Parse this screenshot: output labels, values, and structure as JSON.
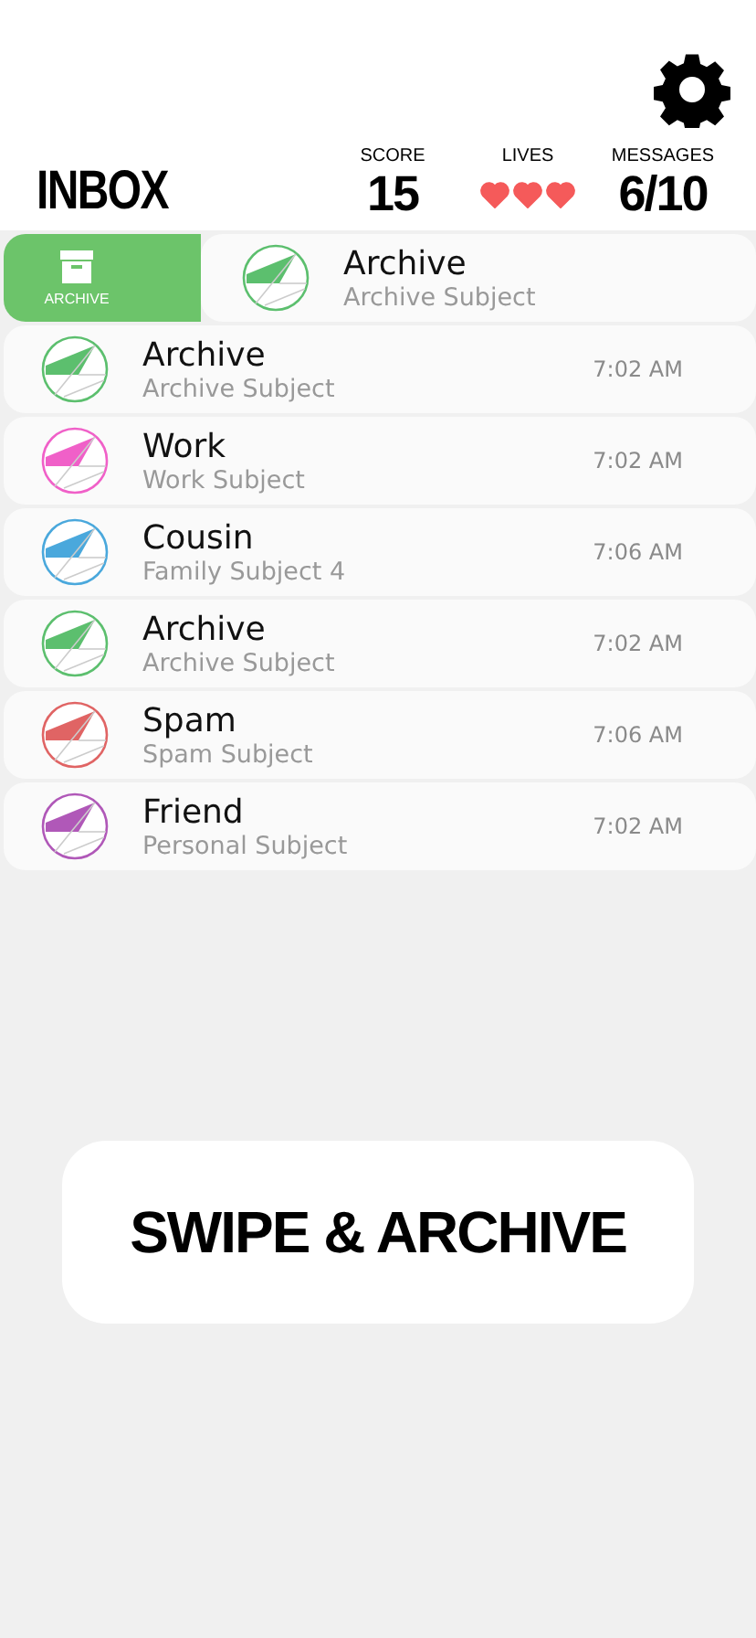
{
  "header": {
    "title": "INBOX",
    "score": {
      "label": "SCORE",
      "value": "15"
    },
    "lives": {
      "label": "LIVES",
      "hearts": [
        {
          "filled": true
        },
        {
          "filled": true
        },
        {
          "filled": true
        }
      ]
    },
    "messages": {
      "label": "MESSAGES",
      "value": "6/10"
    }
  },
  "swipe_action": {
    "label": "ARCHIVE"
  },
  "emails": [
    {
      "sender": "Archive",
      "subject": "Archive Subject",
      "color": "#5cbf6e",
      "swiped": true
    },
    {
      "sender": "Archive",
      "subject": "Archive Subject",
      "time": "7:02 AM",
      "color": "#5cbf6e",
      "swiped": false
    },
    {
      "sender": "Work",
      "subject": "Work Subject",
      "time": "7:02 AM",
      "color": "#f060c8",
      "swiped": false
    },
    {
      "sender": "Cousin",
      "subject": "Family Subject 4",
      "time": "7:06 AM",
      "color": "#4aa8dc",
      "swiped": false
    },
    {
      "sender": "Archive",
      "subject": "Archive Subject",
      "time": "7:02 AM",
      "color": "#5cbf6e",
      "swiped": false
    },
    {
      "sender": "Spam",
      "subject": "Spam Subject",
      "time": "7:06 AM",
      "color": "#e06464",
      "swiped": false
    },
    {
      "sender": "Friend",
      "subject": "Personal Subject",
      "time": "7:02 AM",
      "color": "#b058b8",
      "swiped": false
    }
  ],
  "action_button": {
    "label": "SWIPE & ARCHIVE"
  }
}
